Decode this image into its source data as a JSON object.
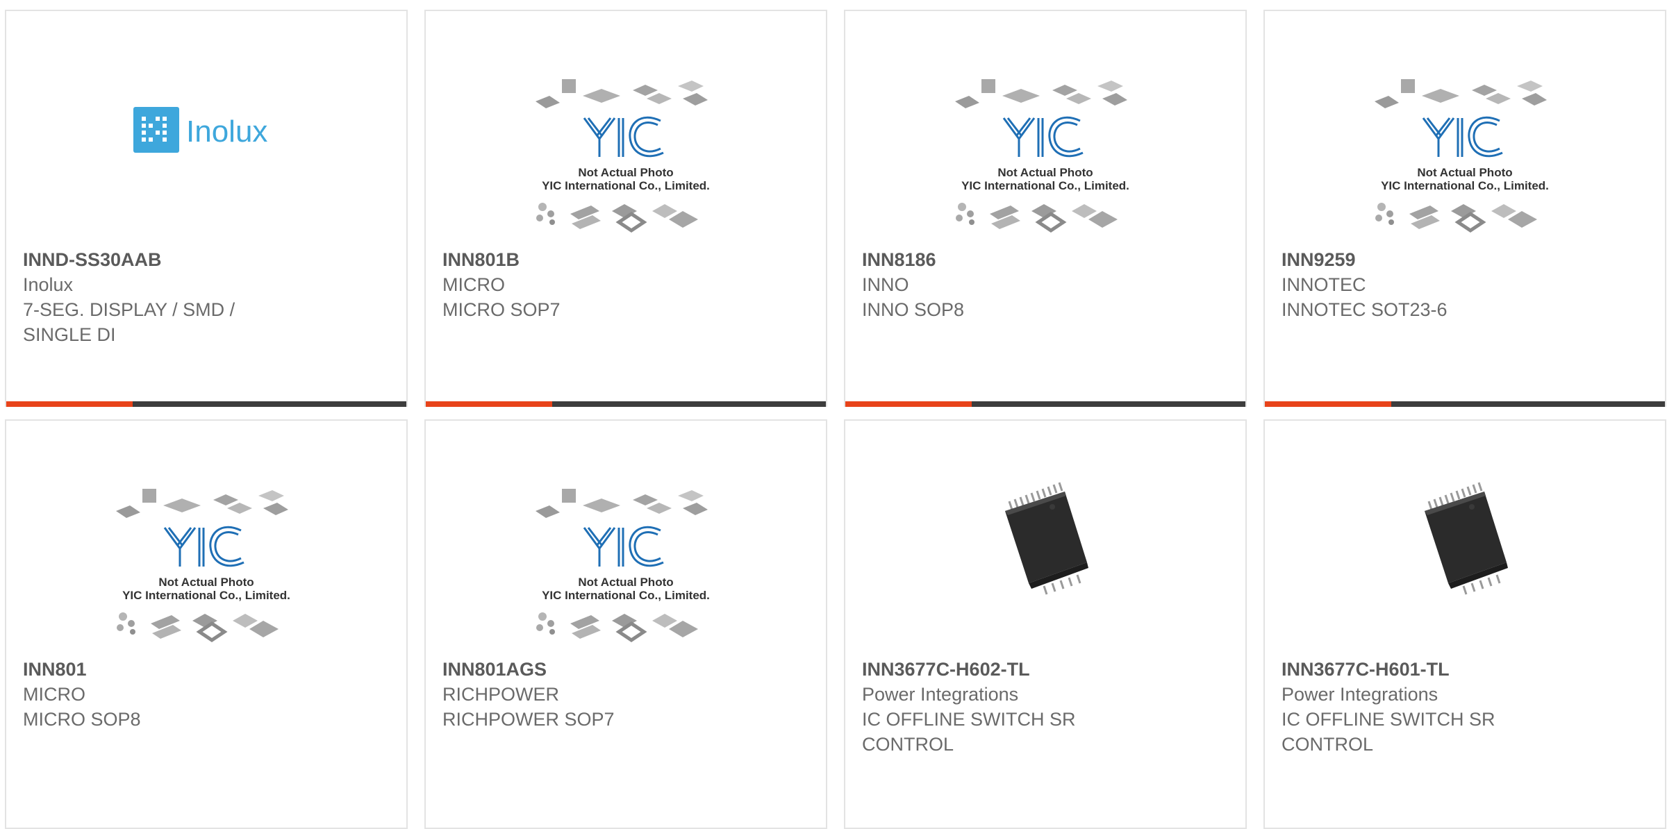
{
  "colors": {
    "accent": "#e8431a",
    "bar": "#3d3d3d",
    "inolux_blue": "#3ea7dc",
    "yic_blue": "#1f6fb5"
  },
  "placeholder": {
    "line1": "Not Actual Photo",
    "line2": "YIC International Co., Limited."
  },
  "inolux_logo_text": "Inolux",
  "products": [
    {
      "part": "INND-SS30AAB",
      "brand": "Inolux",
      "desc": "7-SEG. DISPLAY / SMD / SINGLE DI",
      "image": "inolux-logo"
    },
    {
      "part": "INN801B",
      "brand": "MICRO",
      "desc": "MICRO SOP7",
      "image": "yic-placeholder"
    },
    {
      "part": "INN8186",
      "brand": "INNO",
      "desc": "INNO SOP8",
      "image": "yic-placeholder"
    },
    {
      "part": "INN9259",
      "brand": "INNOTEC",
      "desc": "INNOTEC SOT23-6",
      "image": "yic-placeholder"
    },
    {
      "part": "INN801",
      "brand": "MICRO",
      "desc": "MICRO SOP8",
      "image": "yic-placeholder"
    },
    {
      "part": "INN801AGS",
      "brand": "RICHPOWER",
      "desc": "RICHPOWER SOP7",
      "image": "yic-placeholder"
    },
    {
      "part": "INN3677C-H602-TL",
      "brand": "Power Integrations",
      "desc": "IC OFFLINE SWITCH SR CONTROL",
      "image": "ic-chip"
    },
    {
      "part": "INN3677C-H601-TL",
      "brand": "Power Integrations",
      "desc": "IC OFFLINE SWITCH SR CONTROL",
      "image": "ic-chip"
    }
  ]
}
